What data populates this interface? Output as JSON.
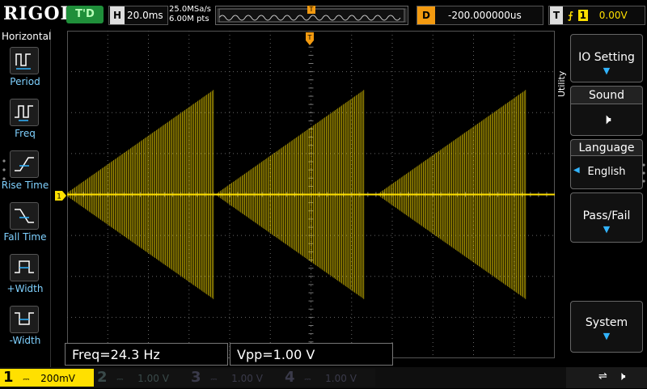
{
  "brand": "RIGOL",
  "top": {
    "run_state": "T'D",
    "horizontal_prefix": "H",
    "timebase": "20.0ms",
    "sample_rate": "25.0MSa/s",
    "memory_depth": "6.00M pts",
    "delay_prefix": "D",
    "delay": "-200.000000us",
    "trigger_prefix": "T",
    "trigger_source": "1",
    "trigger_level": "0.00V"
  },
  "left_panel": {
    "title": "Horizontal",
    "items": [
      {
        "label": "Period",
        "icon": "period-icon"
      },
      {
        "label": "Freq",
        "icon": "freq-icon"
      },
      {
        "label": "Rise Time",
        "icon": "rise-time-icon"
      },
      {
        "label": "Fall Time",
        "icon": "fall-time-icon"
      },
      {
        "label": "+Width",
        "icon": "pos-width-icon"
      },
      {
        "label": "-Width",
        "icon": "neg-width-icon"
      }
    ]
  },
  "right_menu": {
    "title": "Utility",
    "io_setting": "IO Setting",
    "sound_label": "Sound",
    "language_label": "Language",
    "language_value": "English",
    "pass_fail": "Pass/Fail",
    "system": "System"
  },
  "measurements": {
    "freq": "Freq=24.3 Hz",
    "vpp": "Vpp=1.00 V"
  },
  "channels": [
    {
      "num": "1",
      "scale": "200mV",
      "active": true,
      "color": "#ffe000"
    },
    {
      "num": "2",
      "scale": "1.00 V",
      "active": false,
      "color": "#00c8e6"
    },
    {
      "num": "3",
      "scale": "1.00 V",
      "active": false,
      "color": "#d020d0"
    },
    {
      "num": "4",
      "scale": "1.00 V",
      "active": false,
      "color": "#3a6cff"
    }
  ],
  "colors": {
    "ch1": "#ffe000",
    "grid": "#666666",
    "accent": "#32b4ff",
    "trigger_marker": "#f39a10"
  }
}
